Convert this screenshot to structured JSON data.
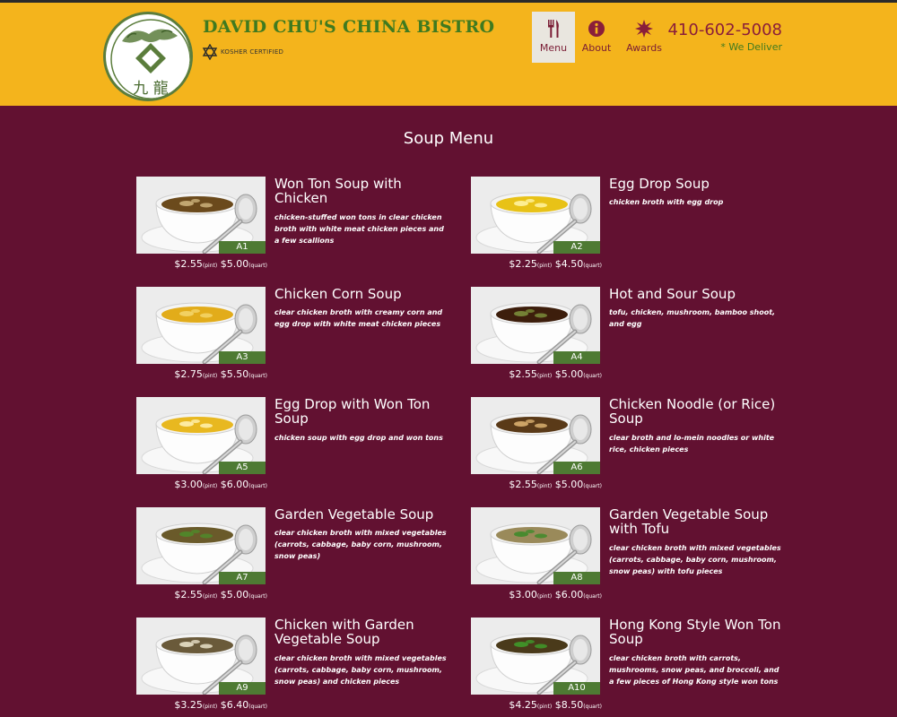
{
  "header": {
    "brand_title": "DAVID CHU'S CHINA BISTRO",
    "kosher_badge": "KOSHER CERTIFIED",
    "logo_glyphs": "九 龍",
    "phone": "410-602-5008",
    "delivery_note": "* We Deliver",
    "nav": [
      {
        "label": "Menu",
        "icon": "fork-knife-icon"
      },
      {
        "label": "About",
        "icon": "info-icon"
      },
      {
        "label": "Awards",
        "icon": "award-burst-icon"
      }
    ],
    "colors": {
      "header_bg": "#f4b41c",
      "page_bg": "#621131",
      "brand_green": "#3f7a1f",
      "accent_red": "#8a1e3a",
      "code_green": "#4e7a33"
    }
  },
  "page": {
    "title": "Soup Menu"
  },
  "items": [
    {
      "code": "A1",
      "name": "Won Ton Soup with Chicken",
      "desc": "chicken-stuffed won tons in clear chicken broth with white meat chicken pieces and a few scallions",
      "price_small": "$2.55",
      "small_label": "(pint)",
      "price_large": "$5.00",
      "large_label": "(quart)"
    },
    {
      "code": "A2",
      "name": "Egg Drop Soup",
      "desc": "chicken broth with egg drop",
      "price_small": "$2.25",
      "small_label": "(pint)",
      "price_large": "$4.50",
      "large_label": "(quart)"
    },
    {
      "code": "A3",
      "name": "Chicken Corn Soup",
      "desc": "clear chicken broth with creamy corn and egg drop with white meat chicken pieces",
      "price_small": "$2.75",
      "small_label": "(pint)",
      "price_large": "$5.50",
      "large_label": "(quart)"
    },
    {
      "code": "A4",
      "name": "Hot and Sour Soup",
      "desc": "tofu, chicken, mushroom, bamboo shoot, and egg",
      "price_small": "$2.55",
      "small_label": "(pint)",
      "price_large": "$5.00",
      "large_label": "(quart)"
    },
    {
      "code": "A5",
      "name": "Egg Drop with Won Ton Soup",
      "desc": "chicken soup with egg drop and won tons",
      "price_small": "$3.00",
      "small_label": "(pint)",
      "price_large": "$6.00",
      "large_label": "(quart)"
    },
    {
      "code": "A6",
      "name": "Chicken Noodle (or Rice) Soup",
      "desc": "clear broth and lo-mein noodles or white rice, chicken pieces",
      "price_small": "$2.55",
      "small_label": "(pint)",
      "price_large": "$5.00",
      "large_label": "(quart)"
    },
    {
      "code": "A7",
      "name": "Garden Vegetable Soup",
      "desc": "clear chicken broth with mixed vegetables (carrots, cabbage, baby corn, mushroom, snow peas)",
      "price_small": "$2.55",
      "small_label": "(pint)",
      "price_large": "$5.00",
      "large_label": "(quart)"
    },
    {
      "code": "A8",
      "name": "Garden Vegetable Soup with Tofu",
      "desc": "clear chicken broth with mixed vegetables (carrots, cabbage, baby corn, mushroom, snow peas) with tofu pieces",
      "price_small": "$3.00",
      "small_label": "(pint)",
      "price_large": "$6.00",
      "large_label": "(quart)"
    },
    {
      "code": "A9",
      "name": "Chicken with Garden Vegetable Soup",
      "desc": "clear chicken broth with mixed vegetables (carrots, cabbage, baby corn, mushroom, snow peas) and chicken pieces",
      "price_small": "$3.25",
      "small_label": "(pint)",
      "price_large": "$6.40",
      "large_label": "(quart)"
    },
    {
      "code": "A10",
      "name": "Hong Kong Style Won Ton Soup",
      "desc": "clear chicken broth with carrots, mushrooms, snow peas, and broccoli, and a few pieces of Hong Kong style won tons",
      "price_small": "$4.25",
      "small_label": "(pint)",
      "price_large": "$8.50",
      "large_label": "(quart)"
    }
  ]
}
